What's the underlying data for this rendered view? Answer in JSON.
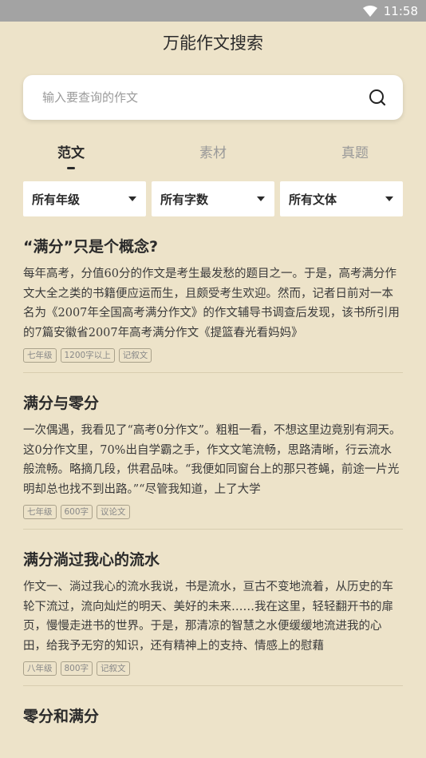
{
  "status": {
    "time": "11:58"
  },
  "title": "万能作文搜索",
  "search": {
    "placeholder": "输入要查询的作文"
  },
  "tabs": [
    "范文",
    "素材",
    "真题"
  ],
  "filters": [
    "所有年级",
    "所有字数",
    "所有文体"
  ],
  "articles": [
    {
      "title": "“满分”只是个概念?",
      "body": "每年高考，分值60分的作文是考生最发愁的题目之一。于是，高考满分作文大全之类的书籍便应运而生，且颇受考生欢迎。然而，记者日前对一本名为《2007年全国高考满分作文》的作文辅导书调查后发现，该书所引用的7篇安徽省2007年高考满分作文《提篮春光看妈妈》",
      "tags": [
        "七年级",
        "1200字以上",
        "记叙文"
      ]
    },
    {
      "title": "满分与零分",
      "body": "一次偶遇，我看见了“高考0分作文”。粗粗一看，不想这里边竟别有洞天。这0分作文里，70%出自学霸之手，作文文笔流畅，思路清晰，行云流水般流畅。略摘几段，供君品味。“我便如同窗台上的那只苍蝇，前途一片光明却总也找不到出路。”“尽管我知道，上了大学",
      "tags": [
        "七年级",
        "600字",
        "议论文"
      ]
    },
    {
      "title": "满分淌过我心的流水",
      "body": "作文一、淌过我心的流水我说，书是流水，亘古不变地流着，从历史的车轮下流过，流向灿烂的明天、美好的未来……我在这里，轻轻翻开书的扉页，慢慢走进书的世界。于是，那清凉的智慧之水便缓缓地流进我的心田，给我予无穷的知识，还有精神上的支持、情感上的慰藉",
      "tags": [
        "八年级",
        "800字",
        "记叙文"
      ]
    },
    {
      "title": "零分和满分",
      "body": "",
      "tags": []
    }
  ]
}
